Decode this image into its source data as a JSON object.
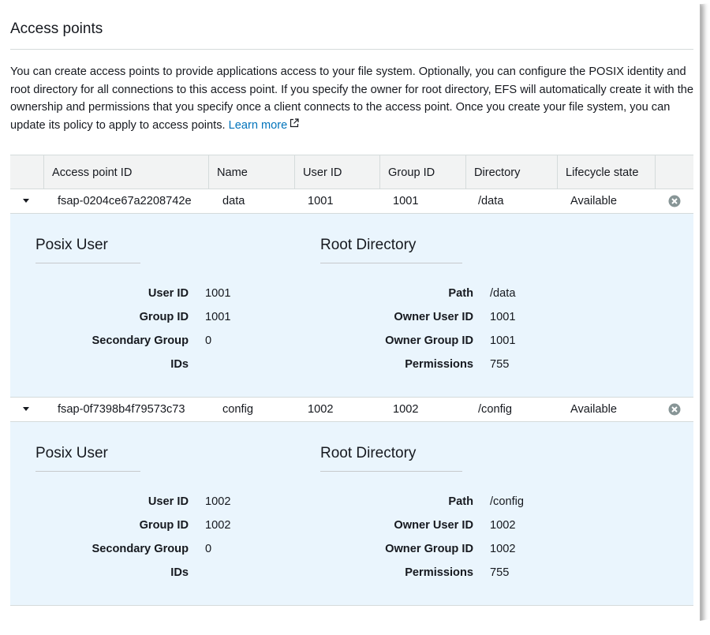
{
  "section": {
    "title": "Access points",
    "description": "You can create access points to provide applications access to your file system. Optionally, you can configure the POSIX identity and root directory for all connections to this access point. If you specify the owner for root directory, EFS will automatically create it with the ownership and permissions that you specify once a client connects to the access point. Once you create your file system, you can update its policy to apply to access points.",
    "learn_more": "Learn more"
  },
  "table": {
    "headers": {
      "id": "Access point ID",
      "name": "Name",
      "user_id": "User ID",
      "group_id": "Group ID",
      "directory": "Directory",
      "lifecycle": "Lifecycle state"
    },
    "rows": [
      {
        "id": "fsap-0204ce67a2208742e",
        "name": "data",
        "user_id": "1001",
        "group_id": "1001",
        "directory": "/data",
        "lifecycle": "Available",
        "details": {
          "posix_title": "Posix User",
          "root_title": "Root Directory",
          "user_id_label": "User ID",
          "user_id": "1001",
          "group_id_label": "Group ID",
          "group_id": "1001",
          "secondary_label_1": "Secondary Group",
          "secondary_label_2": "IDs",
          "secondary_value": "0",
          "path_label": "Path",
          "path": "/data",
          "owner_user_label": "Owner User ID",
          "owner_user": "1001",
          "owner_group_label": "Owner Group ID",
          "owner_group": "1001",
          "permissions_label": "Permissions",
          "permissions": "755"
        }
      },
      {
        "id": "fsap-0f7398b4f79573c73",
        "name": "config",
        "user_id": "1002",
        "group_id": "1002",
        "directory": "/config",
        "lifecycle": "Available",
        "details": {
          "posix_title": "Posix User",
          "root_title": "Root Directory",
          "user_id_label": "User ID",
          "user_id": "1002",
          "group_id_label": "Group ID",
          "group_id": "1002",
          "secondary_label_1": "Secondary Group",
          "secondary_label_2": "IDs",
          "secondary_value": "0",
          "path_label": "Path",
          "path": "/config",
          "owner_user_label": "Owner User ID",
          "owner_user": "1002",
          "owner_group_label": "Owner Group ID",
          "owner_group": "1002",
          "permissions_label": "Permissions",
          "permissions": "755"
        }
      }
    ]
  },
  "colors": {
    "link": "#0073bb",
    "detail_bg": "#eaf5fd",
    "header_bg": "#f2f3f3",
    "border": "#d5dbdb"
  }
}
